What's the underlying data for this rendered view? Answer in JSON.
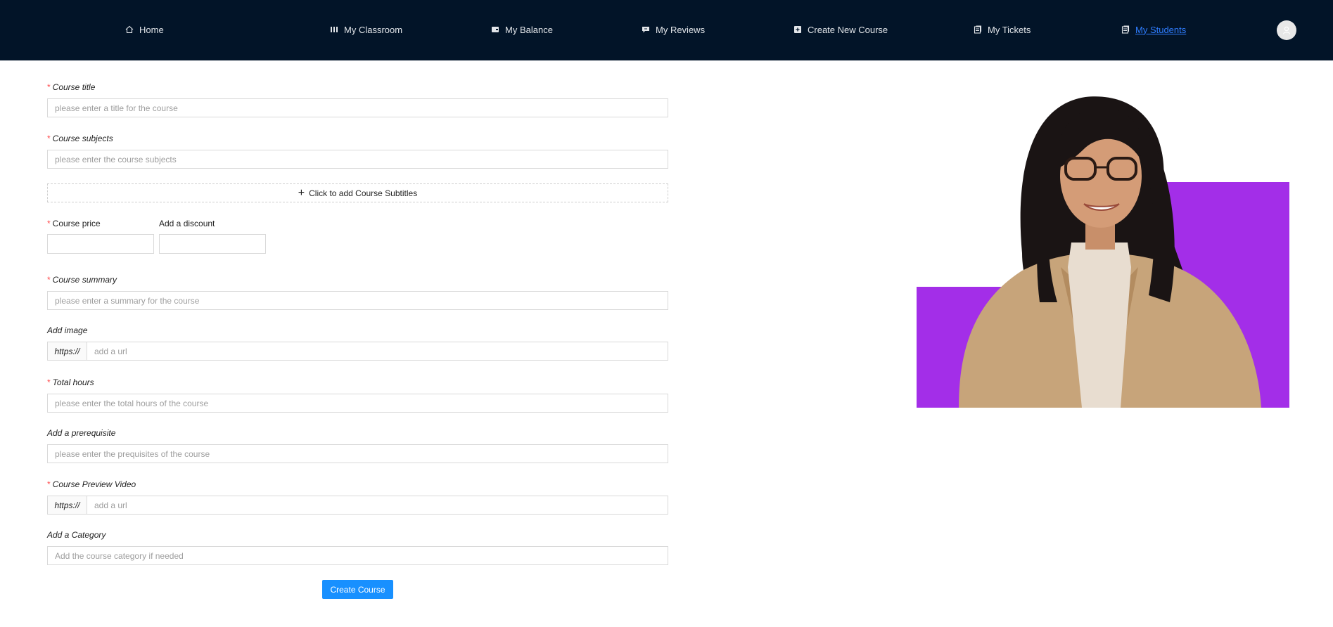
{
  "nav": {
    "items": [
      {
        "label": "Home",
        "icon": "home-icon"
      },
      {
        "label": "My Classroom",
        "icon": "classroom-icon"
      },
      {
        "label": "My Balance",
        "icon": "wallet-icon"
      },
      {
        "label": "My Reviews",
        "icon": "review-icon"
      },
      {
        "label": "Create New Course",
        "icon": "plus-square-icon"
      },
      {
        "label": "My Tickets",
        "icon": "ticket-icon"
      },
      {
        "label": "My Students",
        "icon": "students-icon",
        "active": true
      }
    ],
    "avatar_icon": "user-icon"
  },
  "form": {
    "course_title": {
      "label": "Course title",
      "placeholder": "please enter a title for the course"
    },
    "course_subjects": {
      "label": "Course subjects",
      "placeholder": "please enter the course subjects"
    },
    "add_subtitles": {
      "label": "Click to add Course Subtitles"
    },
    "course_price": {
      "label": "Course price"
    },
    "discount": {
      "label": "Add a discount"
    },
    "course_summary": {
      "label": "Course summary",
      "placeholder": "please enter a summary for the course"
    },
    "image": {
      "label": "Add image",
      "addon": "https://",
      "placeholder": "add a url"
    },
    "total_hours": {
      "label": "Total hours",
      "placeholder": "please enter the total hours of the course"
    },
    "prerequisite": {
      "label": "Add a prerequisite",
      "placeholder": "please enter the prequisites of the course"
    },
    "preview_video": {
      "label": "Course Preview Video",
      "addon": "https://",
      "placeholder": "add a url"
    },
    "category": {
      "label": "Add a Category",
      "placeholder": "Add the course category if needed"
    },
    "submit_label": "Create Course",
    "required_mark": "*"
  },
  "colors": {
    "nav_bg": "#021428",
    "accent": "#1890ff",
    "active_link": "#2f7dff",
    "required": "#ff4d4f",
    "hero_purple": "#a32ee8"
  }
}
